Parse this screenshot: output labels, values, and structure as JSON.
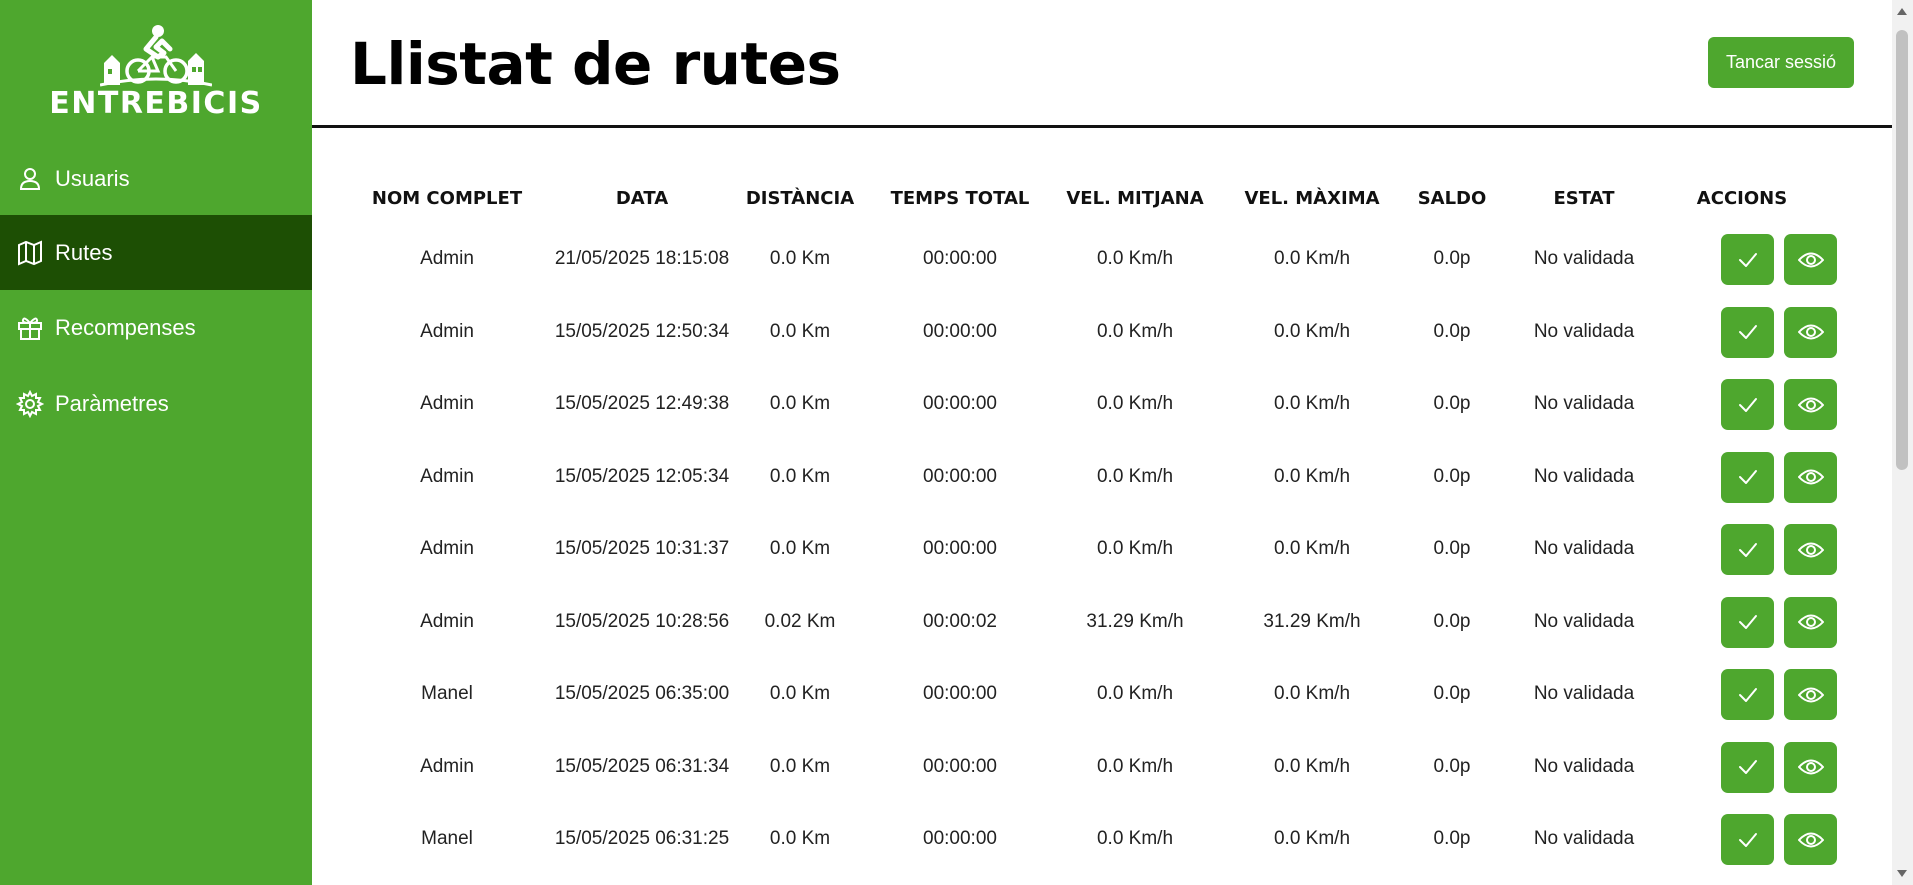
{
  "brand": {
    "name": "ENTREBICIS"
  },
  "sidebar": {
    "items": [
      {
        "label": "Usuaris",
        "icon": "user-icon",
        "active": false
      },
      {
        "label": "Rutes",
        "icon": "map-icon",
        "active": true
      },
      {
        "label": "Recompenses",
        "icon": "gift-icon",
        "active": false
      },
      {
        "label": "Paràmetres",
        "icon": "gear-icon",
        "active": false
      }
    ]
  },
  "header": {
    "title": "Llistat de rutes",
    "logout_label": "Tancar sessió"
  },
  "colors": {
    "accent": "#4ea72e",
    "active": "#1d4f04"
  },
  "table": {
    "headers": [
      "NOM COMPLET",
      "DATA",
      "DISTÀNCIA",
      "TEMPS TOTAL",
      "VEL. MITJANA",
      "VEL. MÀXIMA",
      "SALDO",
      "ESTAT",
      "ACCIONS"
    ],
    "rows": [
      [
        "Admin",
        "21/05/2025 18:15:08",
        "0.0 Km",
        "00:00:00",
        "0.0 Km/h",
        "0.0 Km/h",
        "0.0p",
        "No validada"
      ],
      [
        "Admin",
        "15/05/2025 12:50:34",
        "0.0 Km",
        "00:00:00",
        "0.0 Km/h",
        "0.0 Km/h",
        "0.0p",
        "No validada"
      ],
      [
        "Admin",
        "15/05/2025 12:49:38",
        "0.0 Km",
        "00:00:00",
        "0.0 Km/h",
        "0.0 Km/h",
        "0.0p",
        "No validada"
      ],
      [
        "Admin",
        "15/05/2025 12:05:34",
        "0.0 Km",
        "00:00:00",
        "0.0 Km/h",
        "0.0 Km/h",
        "0.0p",
        "No validada"
      ],
      [
        "Admin",
        "15/05/2025 10:31:37",
        "0.0 Km",
        "00:00:00",
        "0.0 Km/h",
        "0.0 Km/h",
        "0.0p",
        "No validada"
      ],
      [
        "Admin",
        "15/05/2025 10:28:56",
        "0.02 Km",
        "00:00:02",
        "31.29 Km/h",
        "31.29 Km/h",
        "0.0p",
        "No validada"
      ],
      [
        "Manel",
        "15/05/2025 06:35:00",
        "0.0 Km",
        "00:00:00",
        "0.0 Km/h",
        "0.0 Km/h",
        "0.0p",
        "No validada"
      ],
      [
        "Admin",
        "15/05/2025 06:31:34",
        "0.0 Km",
        "00:00:00",
        "0.0 Km/h",
        "0.0 Km/h",
        "0.0p",
        "No validada"
      ],
      [
        "Manel",
        "15/05/2025 06:31:25",
        "0.0 Km",
        "00:00:00",
        "0.0 Km/h",
        "0.0 Km/h",
        "0.0p",
        "No validada"
      ]
    ],
    "row_actions": [
      {
        "icon": "check-icon"
      },
      {
        "icon": "eye-icon"
      }
    ]
  }
}
